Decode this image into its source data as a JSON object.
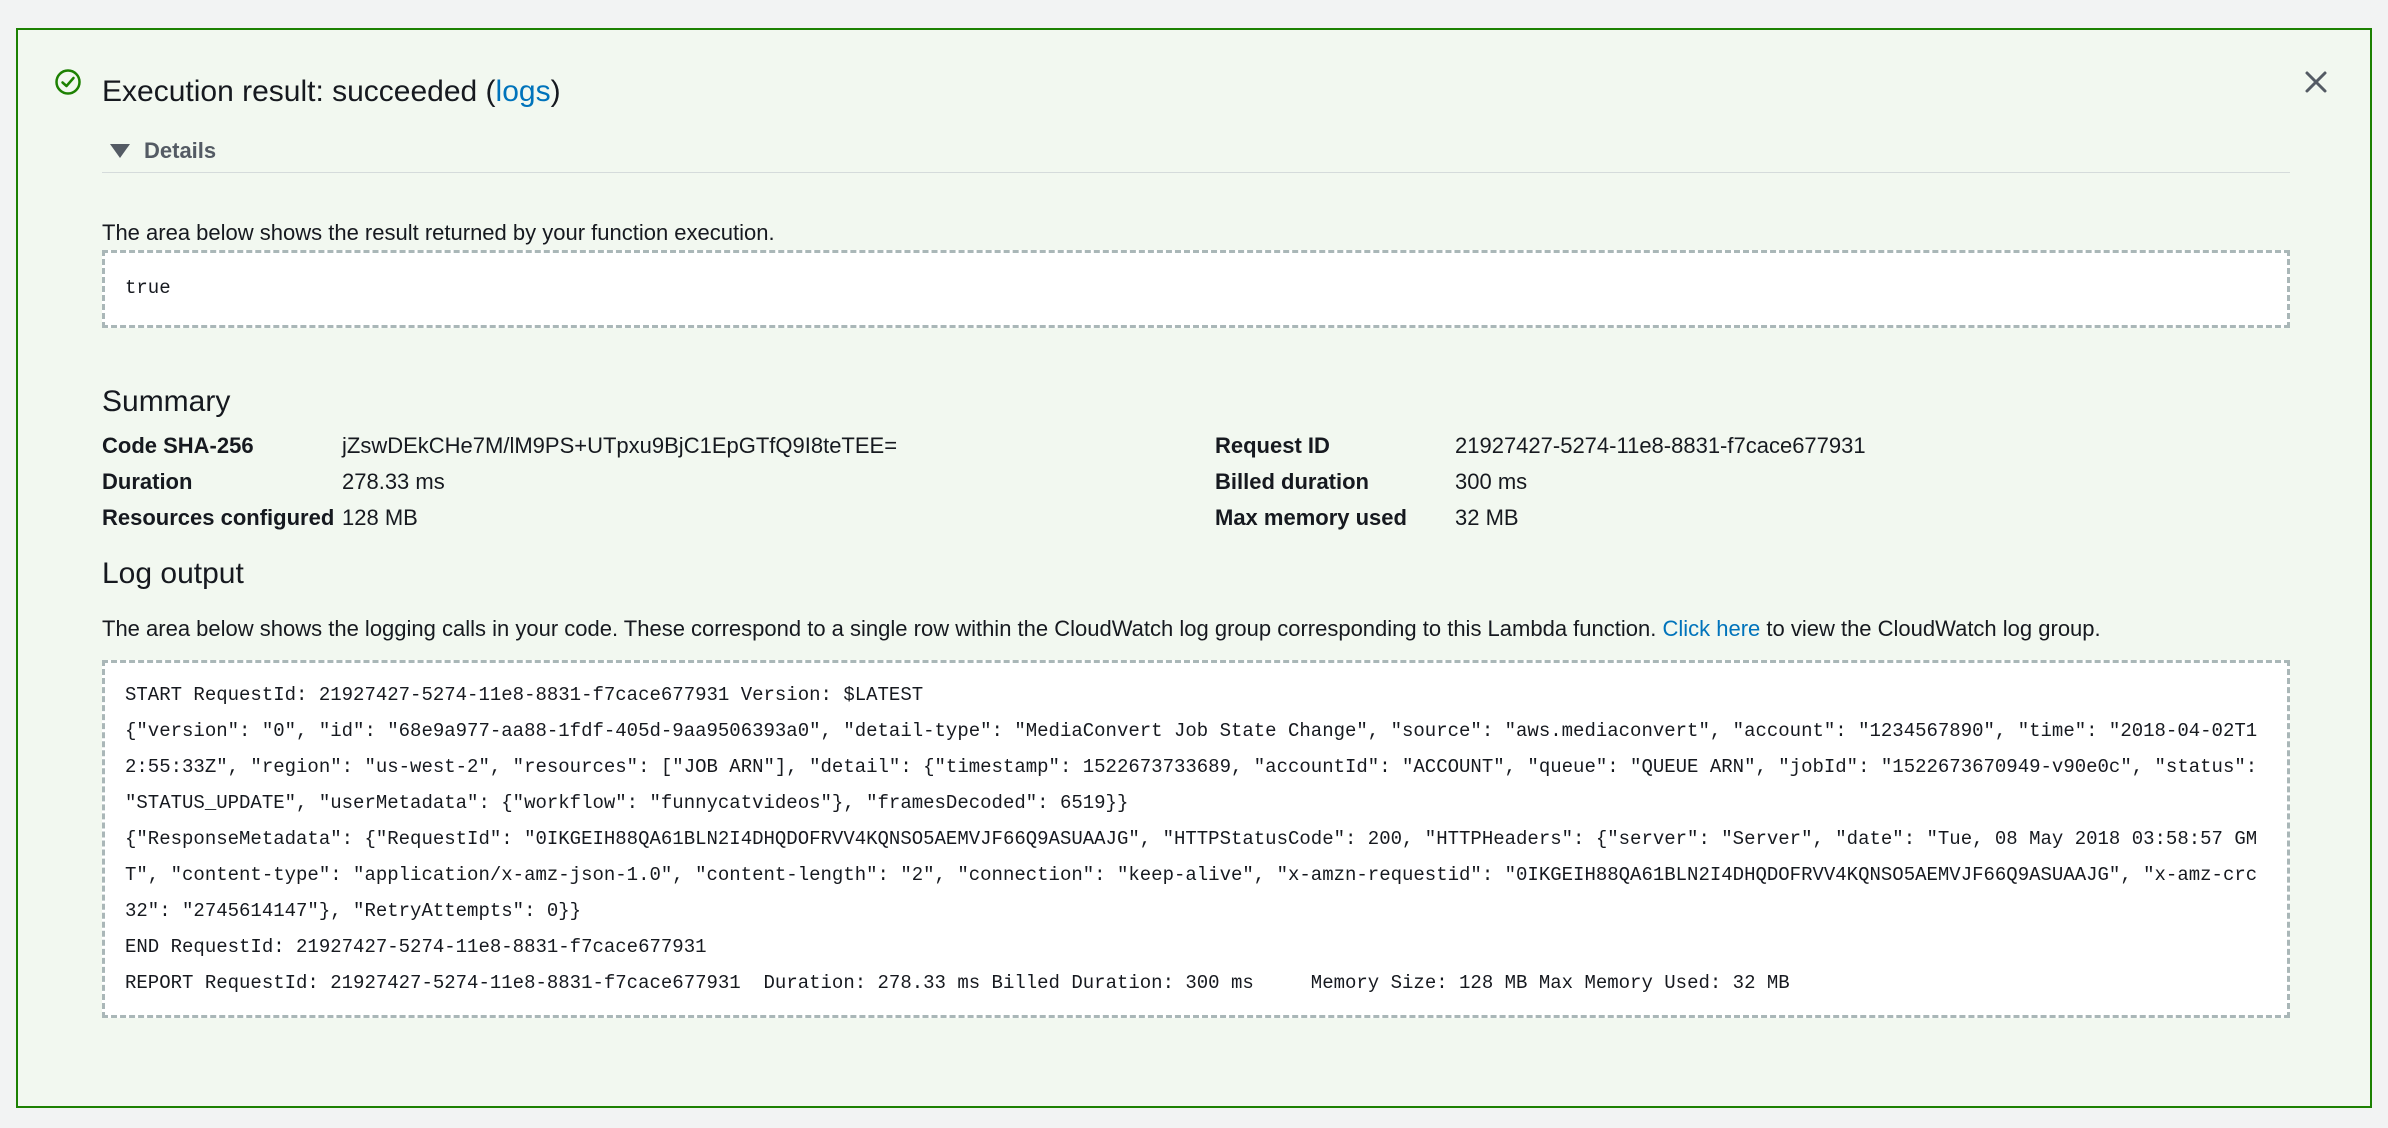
{
  "header": {
    "title_prefix": "Execution result: succeeded (",
    "title_link": "logs",
    "title_suffix": ")",
    "details_label": "Details"
  },
  "result": {
    "description": "The area below shows the result returned by your function execution.",
    "value": "true"
  },
  "summary": {
    "heading": "Summary",
    "left": [
      {
        "label": "Code SHA-256",
        "value": "jZswDEkCHe7M/lM9PS+UTpxu9BjC1EpGTfQ9I8teTEE="
      },
      {
        "label": "Duration",
        "value": "278.33 ms"
      },
      {
        "label": "Resources configured",
        "value": "128 MB"
      }
    ],
    "right": [
      {
        "label": "Request ID",
        "value": "21927427-5274-11e8-8831-f7cace677931"
      },
      {
        "label": "Billed duration",
        "value": "300 ms"
      },
      {
        "label": "Max memory used",
        "value": "32 MB"
      }
    ]
  },
  "log": {
    "heading": "Log output",
    "description_prefix": "The area below shows the logging calls in your code. These correspond to a single row within the CloudWatch log group corresponding to this Lambda function. ",
    "description_link": "Click here",
    "description_suffix": " to view the CloudWatch log group.",
    "lines": [
      "START RequestId: 21927427-5274-11e8-8831-f7cace677931 Version: $LATEST",
      "{\"version\": \"0\", \"id\": \"68e9a977-aa88-1fdf-405d-9aa9506393a0\", \"detail-type\": \"MediaConvert Job State Change\", \"source\": \"aws.mediaconvert\", \"account\": \"1234567890\", \"time\": \"2018-04-02T12:55:33Z\", \"region\": \"us-west-2\", \"resources\": [\"JOB ARN\"], \"detail\": {\"timestamp\": 1522673733689, \"accountId\": \"ACCOUNT\", \"queue\": \"QUEUE ARN\", \"jobId\": \"1522673670949-v90e0c\", \"status\": \"STATUS_UPDATE\", \"userMetadata\": {\"workflow\": \"funnycatvideos\"}, \"framesDecoded\": 6519}}",
      "{\"ResponseMetadata\": {\"RequestId\": \"0IKGEIH88QA61BLN2I4DHQDOFRVV4KQNSO5AEMVJF66Q9ASUAAJG\", \"HTTPStatusCode\": 200, \"HTTPHeaders\": {\"server\": \"Server\", \"date\": \"Tue, 08 May 2018 03:58:57 GMT\", \"content-type\": \"application/x-amz-json-1.0\", \"content-length\": \"2\", \"connection\": \"keep-alive\", \"x-amzn-requestid\": \"0IKGEIH88QA61BLN2I4DHQDOFRVV4KQNSO5AEMVJF66Q9ASUAAJG\", \"x-amz-crc32\": \"2745614147\"}, \"RetryAttempts\": 0}}",
      "END RequestId: 21927427-5274-11e8-8831-f7cace677931",
      "REPORT RequestId: 21927427-5274-11e8-8831-f7cace677931\tDuration: 278.33 ms\tBilled Duration: 300 ms \tMemory Size: 128 MB\tMax Memory Used: 32 MB"
    ]
  },
  "colors": {
    "success": "#1d8102",
    "link": "#0073bb"
  },
  "icons": {
    "status": "check-circle-icon",
    "close": "close-icon",
    "toggle": "caret-down-icon"
  }
}
